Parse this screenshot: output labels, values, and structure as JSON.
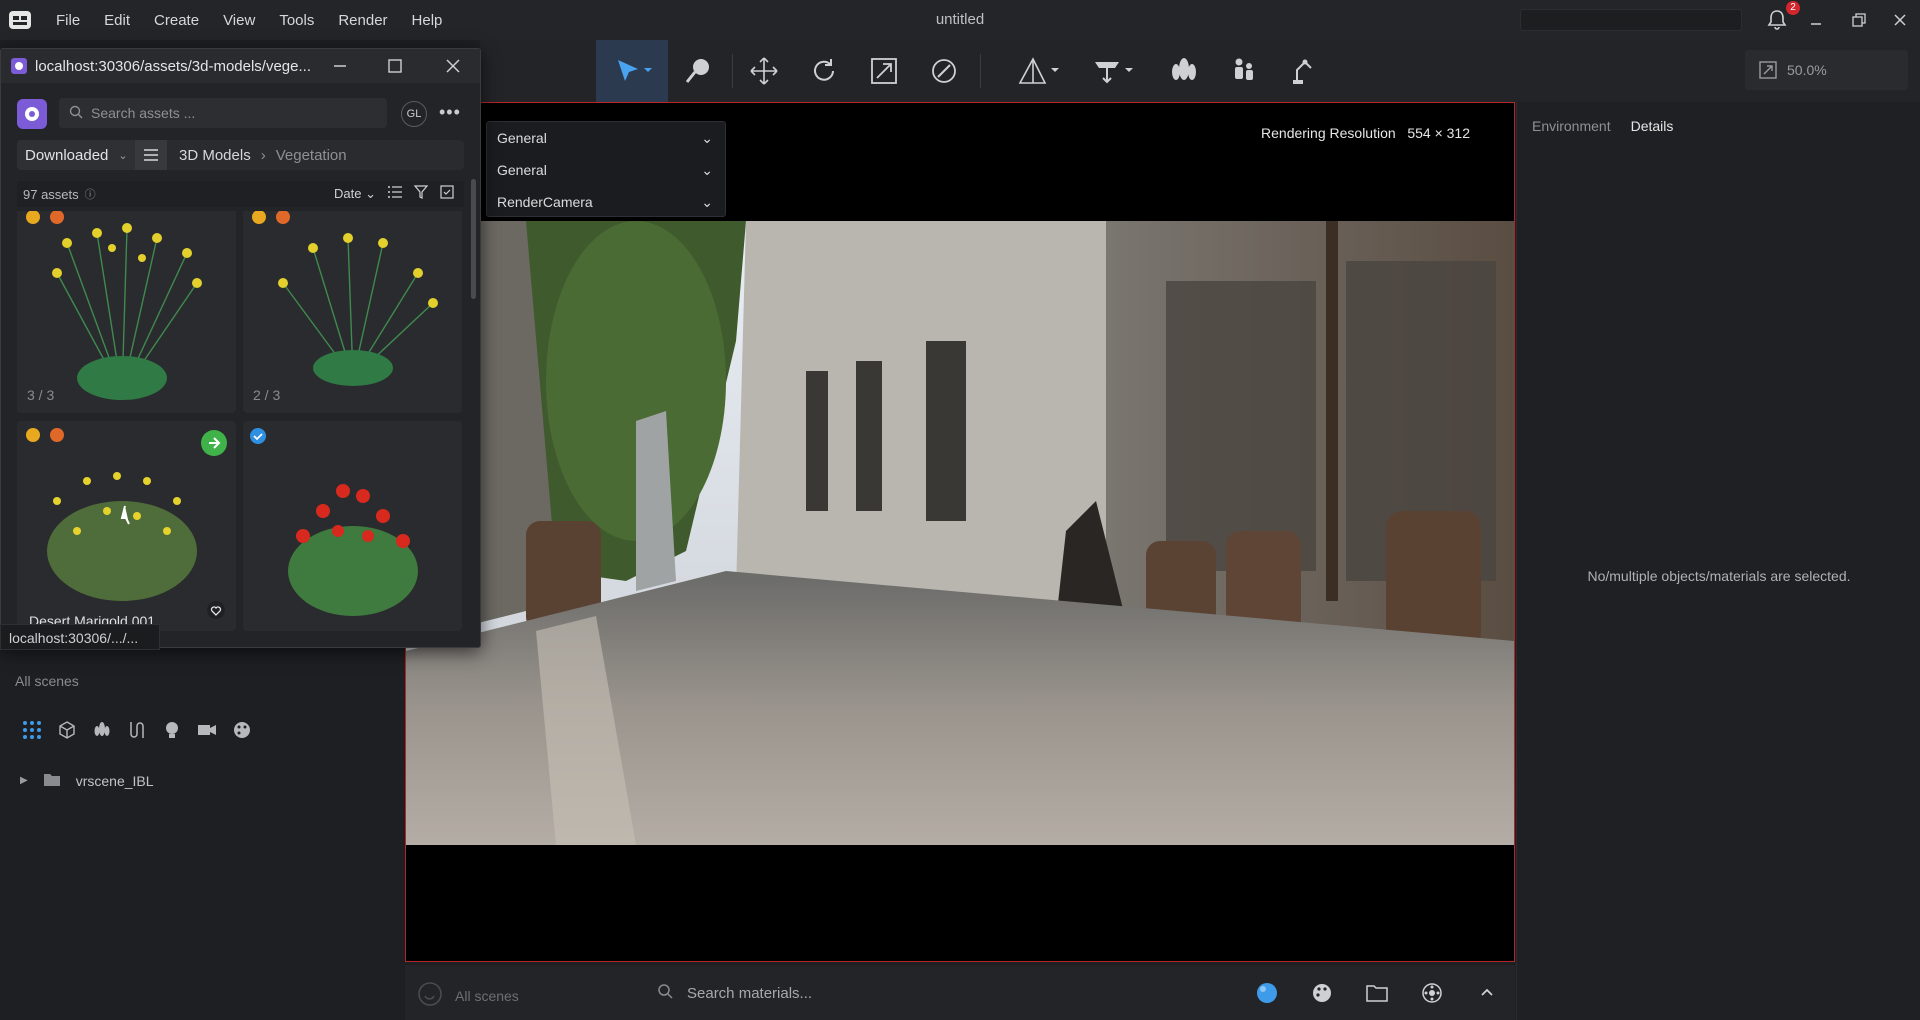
{
  "menubar": {
    "items": [
      "File",
      "Edit",
      "Create",
      "View",
      "Tools",
      "Render",
      "Help"
    ],
    "title": "untitled",
    "notifications_count": "2"
  },
  "toolbar": {
    "tools": [
      "select-arrow-icon",
      "paint-select-icon",
      "move-icon",
      "rotate-icon",
      "scale-icon",
      "scatter-icon",
      "place-on-surface-icon",
      "light-icon",
      "vegetation-icon",
      "people-icon",
      "robot-arm-icon"
    ],
    "zoom": "50.0%"
  },
  "viewport": {
    "rendering_resolution_label": "Rendering Resolution",
    "rendering_resolution_value": "554 × 312",
    "dropdowns": [
      "General",
      "General",
      "RenderCamera"
    ]
  },
  "right_panel": {
    "tabs": [
      "Environment",
      "Details"
    ],
    "active_tab": "Details",
    "empty_message": "No/multiple objects/materials are selected."
  },
  "asset_window": {
    "title": "localhost:30306/assets/3d-models/vege...",
    "search_placeholder": "Search assets ...",
    "user_initials": "GL",
    "source": "Downloaded",
    "breadcrumb": [
      "3D Models",
      "Vegetation"
    ],
    "count": "97 assets",
    "sort": "Date",
    "cards": [
      {
        "counter": "3 / 3",
        "name": ""
      },
      {
        "counter": "2 / 3",
        "name": ""
      },
      {
        "counter": "",
        "name": "Desert Marigold 001"
      },
      {
        "counter": "",
        "name": ""
      }
    ]
  },
  "tooltip": "localhost:30306/.../...",
  "left_panel": {
    "all_scenes": "All scenes",
    "tree_item": "vrscene_IBL"
  },
  "bottom_bar": {
    "all_scenes": "All scenes",
    "search_placeholder": "Search materials..."
  }
}
